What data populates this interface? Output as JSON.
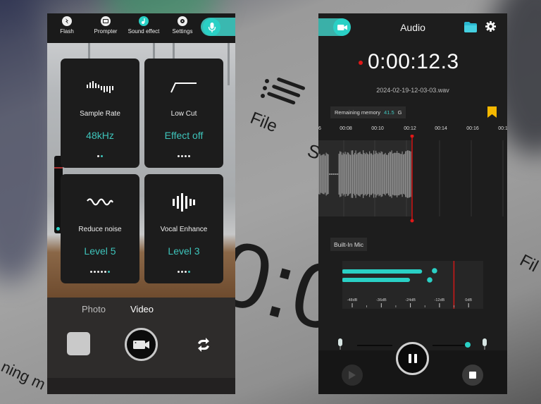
{
  "background": {
    "blurred_texts": [
      "File",
      "S",
      "0:0",
      "Fil",
      "ning m"
    ]
  },
  "left_app": {
    "toolbar": {
      "items": [
        {
          "label": "Flash",
          "icon": "flash-icon"
        },
        {
          "label": "Prompter",
          "icon": "prompter-icon"
        },
        {
          "label": "Sound effect",
          "icon": "music-note-icon"
        },
        {
          "label": "Settings",
          "icon": "gear-icon"
        }
      ],
      "active_mode_icon": "microphone-icon"
    },
    "effect_cards": [
      {
        "label": "Sample Rate",
        "value": "48kHz",
        "icon": "sample-rate-icon",
        "dots": 2,
        "active_dot": 2
      },
      {
        "label": "Low Cut",
        "value": "Effect off",
        "icon": "low-cut-icon",
        "dots": 4,
        "active_dot": 0
      },
      {
        "label": "Reduce noise",
        "value": "Level 5",
        "icon": "wave-icon",
        "dots": 6,
        "active_dot": 6
      },
      {
        "label": "Vocal Enhance",
        "value": "Level 3",
        "icon": "vocal-bars-icon",
        "dots": 4,
        "active_dot": 4
      }
    ],
    "modes": {
      "photo": "Photo",
      "video": "Video",
      "selected": "Video"
    }
  },
  "right_app": {
    "title": "Audio",
    "timer": "0:00:12.3",
    "filename": "2024-02-19-12-03-03.wav",
    "memory": {
      "label": "Remaining memory",
      "value": "41.5",
      "unit": "G"
    },
    "timeline_ticks": [
      "6",
      "00:08",
      "00:10",
      "00:12",
      "00:14",
      "00:16",
      "00:1"
    ],
    "playhead_time": "00:12",
    "input_source": "Built-In Mic",
    "vu_meter": {
      "ticks": [
        "-48dB",
        "-36dB",
        "-24dB",
        "-12dB",
        "0dB"
      ],
      "channel_levels_db": [
        -20,
        -25
      ],
      "channel_peaks_db": [
        -14,
        -16
      ],
      "threshold_db": -6
    },
    "gain_level": 0.95,
    "colors": {
      "accent": "#2ad0c5",
      "record": "#e01818",
      "bookmark": "#f5b800"
    }
  }
}
